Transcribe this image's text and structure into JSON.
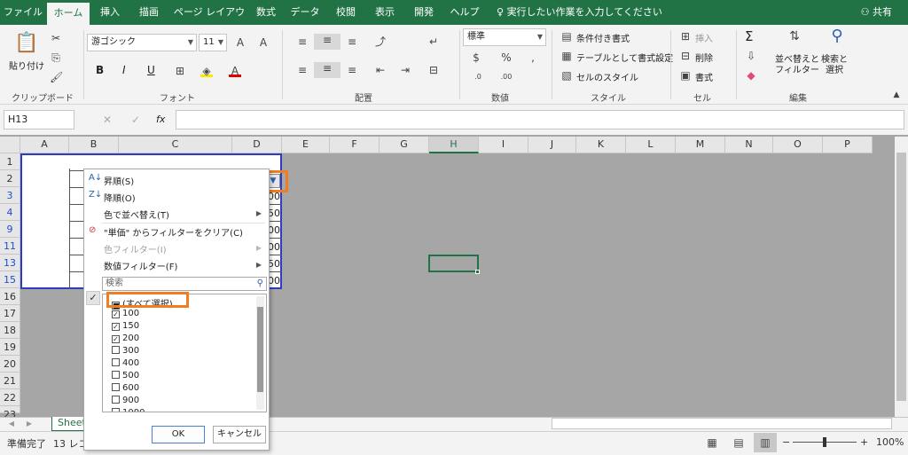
{
  "tabs": [
    "ファイル",
    "ホーム",
    "挿入",
    "描画",
    "ページ レイアウト",
    "数式",
    "データ",
    "校閲",
    "表示",
    "開発",
    "ヘルプ"
  ],
  "active_tab": "ホーム",
  "tell_me": "実行したい作業を入力してください",
  "share": "共有",
  "ribbon": {
    "paste": "貼り付け",
    "clipboard": "クリップボード",
    "font_name": "游ゴシック",
    "font_size": "11",
    "font": "フォント",
    "bold": "B",
    "italic": "I",
    "underline": "U",
    "alignment": "配置",
    "number_format": "標準",
    "number": "数値",
    "cond_format": "条件付き書式",
    "table_format": "テーブルとして書式設定",
    "cell_style": "セルのスタイル",
    "styles": "スタイル",
    "insert": "挿入",
    "delete": "削除",
    "format": "書式",
    "cells": "セル",
    "sum": "Σ",
    "sort_filter": "並べ替えと\nフィルター",
    "find_select": "検索と\n選択",
    "editing": "編集"
  },
  "name_box": "H13",
  "fx": "fx",
  "columns": [
    "A",
    "B",
    "C",
    "D",
    "E",
    "F",
    "G",
    "H",
    "I",
    "J",
    "K",
    "L",
    "M",
    "N",
    "O",
    "P"
  ],
  "rows": [
    "1",
    "2",
    "3",
    "4",
    "9",
    "11",
    "13",
    "15",
    "16",
    "17",
    "18",
    "19",
    "20",
    "21",
    "22",
    "23"
  ],
  "visible_values": [
    "00",
    "50",
    "00",
    "00",
    "50",
    "00"
  ],
  "sheet_tab": "Sheet",
  "status": {
    "ready": "準備完了",
    "count": "13 レコ",
    "zoom": "100%"
  },
  "dropdown": {
    "sort_asc": "昇順(S)",
    "sort_desc": "降順(O)",
    "sort_color": "色で並べ替え(T)",
    "clear_filter": "\"単価\" からフィルターをクリア(C)",
    "color_filter": "色フィルター(I)",
    "number_filter": "数値フィルター(F)",
    "search_placeholder": "検索",
    "select_all": "(すべて選択)",
    "items": [
      {
        "label": "100",
        "checked": true
      },
      {
        "label": "150",
        "checked": true
      },
      {
        "label": "200",
        "checked": true
      },
      {
        "label": "300",
        "checked": false
      },
      {
        "label": "400",
        "checked": false
      },
      {
        "label": "500",
        "checked": false
      },
      {
        "label": "600",
        "checked": false
      },
      {
        "label": "900",
        "checked": false
      },
      {
        "label": "1000",
        "checked": false
      }
    ],
    "ok": "OK",
    "cancel": "キャンセル"
  },
  "colors": {
    "excel_green": "#217346",
    "highlight": "#ef7d22",
    "table_border": "#2e3cc0"
  }
}
